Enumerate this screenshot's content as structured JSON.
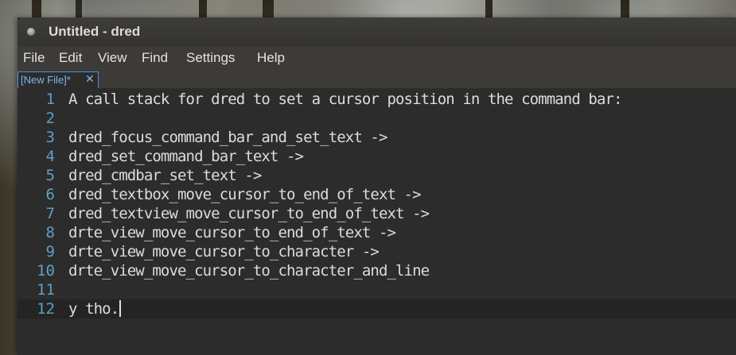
{
  "window": {
    "title": "Untitled - dred"
  },
  "menubar": {
    "items": [
      "File",
      "Edit",
      "View",
      "Find",
      "Settings",
      "Help"
    ]
  },
  "tabs": [
    {
      "label": "[New File]*",
      "close_glyph": "✕"
    }
  ],
  "editor": {
    "current_line": 12,
    "lines": [
      {
        "number": "1",
        "text": "A call stack for dred to set a cursor position in the command bar:"
      },
      {
        "number": "2",
        "text": ""
      },
      {
        "number": "3",
        "text": "dred_focus_command_bar_and_set_text ->"
      },
      {
        "number": "4",
        "text": "dred_set_command_bar_text ->"
      },
      {
        "number": "5",
        "text": "dred_cmdbar_set_text ->"
      },
      {
        "number": "6",
        "text": "dred_textbox_move_cursor_to_end_of_text ->"
      },
      {
        "number": "7",
        "text": "dred_textview_move_cursor_to_end_of_text ->"
      },
      {
        "number": "8",
        "text": "drte_view_move_cursor_to_end_of_text ->"
      },
      {
        "number": "9",
        "text": "drte_view_move_cursor_to_character ->"
      },
      {
        "number": "10",
        "text": "drte_view_move_cursor_to_character_and_line"
      },
      {
        "number": "11",
        "text": ""
      },
      {
        "number": "12",
        "text": "y tho."
      }
    ]
  },
  "colors": {
    "line_number": "#5e9fc7",
    "editor_background": "#2c2c2c",
    "current_line_background": "#242424",
    "tab_accent": "#4a90d9"
  }
}
